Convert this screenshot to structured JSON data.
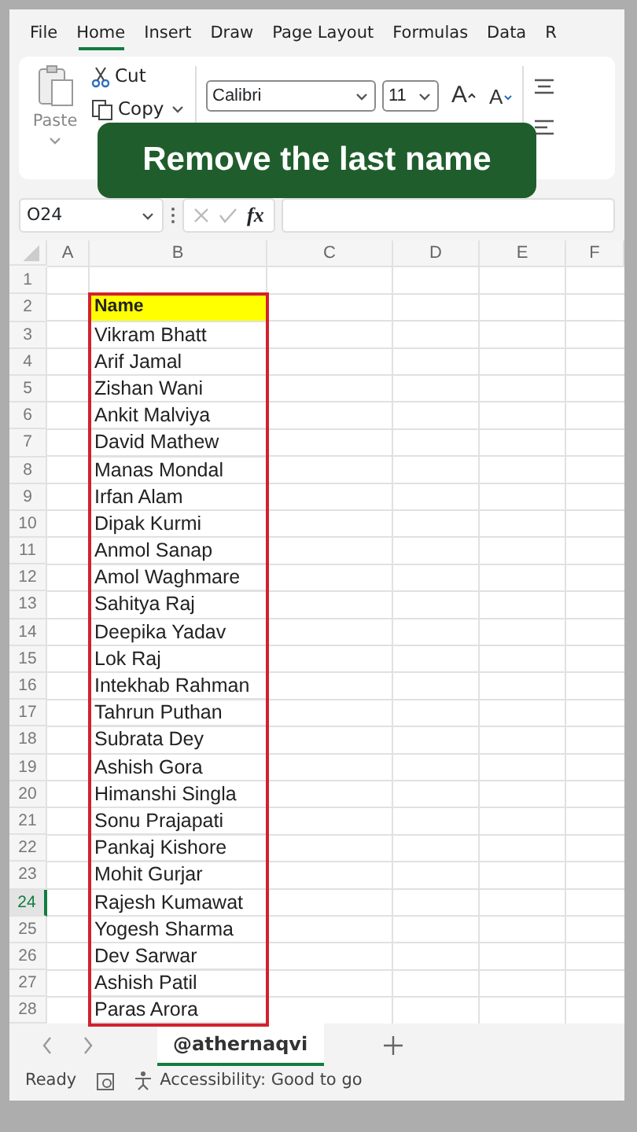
{
  "menu_tabs": [
    {
      "label": "File",
      "selected": false
    },
    {
      "label": "Home",
      "selected": true
    },
    {
      "label": "Insert",
      "selected": false
    },
    {
      "label": "Draw",
      "selected": false
    },
    {
      "label": "Page Layout",
      "selected": false
    },
    {
      "label": "Formulas",
      "selected": false
    },
    {
      "label": "Data",
      "selected": false
    },
    {
      "label": "R",
      "selected": false
    }
  ],
  "ribbon": {
    "paste": "Paste",
    "cut": "Cut",
    "copy": "Copy",
    "font": "Calibri",
    "size": "11",
    "grow_font": "A",
    "shrink_font": "A"
  },
  "banner": "Remove the last name",
  "formula_bar": {
    "name_box": "O24",
    "function_label": "fx"
  },
  "columns": [
    "A",
    "B",
    "C",
    "D",
    "E",
    "F"
  ],
  "rows": [
    {
      "number": "1",
      "selected": false
    },
    {
      "number": "2",
      "selected": false
    },
    {
      "number": "3",
      "selected": false
    },
    {
      "number": "4",
      "selected": false
    },
    {
      "number": "5",
      "selected": false
    },
    {
      "number": "6",
      "selected": false
    },
    {
      "number": "7",
      "selected": false
    },
    {
      "number": "8",
      "selected": false
    },
    {
      "number": "9",
      "selected": false
    },
    {
      "number": "10",
      "selected": false
    },
    {
      "number": "11",
      "selected": false
    },
    {
      "number": "12",
      "selected": false
    },
    {
      "number": "13",
      "selected": false
    },
    {
      "number": "14",
      "selected": false
    },
    {
      "number": "15",
      "selected": false
    },
    {
      "number": "16",
      "selected": false
    },
    {
      "number": "17",
      "selected": false
    },
    {
      "number": "18",
      "selected": false
    },
    {
      "number": "19",
      "selected": false
    },
    {
      "number": "20",
      "selected": false
    },
    {
      "number": "21",
      "selected": false
    },
    {
      "number": "22",
      "selected": false
    },
    {
      "number": "23",
      "selected": false
    },
    {
      "number": "24",
      "selected": true
    },
    {
      "number": "25",
      "selected": false
    },
    {
      "number": "26",
      "selected": false
    },
    {
      "number": "27",
      "selected": false
    },
    {
      "number": "28",
      "selected": false
    }
  ],
  "name_column": {
    "heading": "Name",
    "entries": [
      "Vikram Bhatt",
      "Arif Jamal",
      "Zishan Wani",
      "Ankit Malviya",
      "David Mathew",
      "Manas Mondal",
      "Irfan Alam",
      "Dipak Kurmi",
      "Anmol Sanap",
      "Amol Waghmare",
      "Sahitya Raj",
      "Deepika Yadav",
      "Lok Raj",
      "Intekhab Rahman",
      "Tahrun Puthan",
      "Subrata Dey",
      "Ashish Gora",
      "Himanshi Singla",
      "Sonu Prajapati",
      "Pankaj Kishore",
      "Mohit Gurjar",
      "Rajesh Kumawat",
      "Yogesh Sharma",
      "Dev Sarwar",
      "Ashish Patil",
      "Paras Arora"
    ]
  },
  "sheet_tabs": [
    {
      "label": "@athernaqvi",
      "selected": true
    }
  ],
  "status_bar": {
    "state": "Ready",
    "accessibility": "Accessibility: Good to go"
  }
}
